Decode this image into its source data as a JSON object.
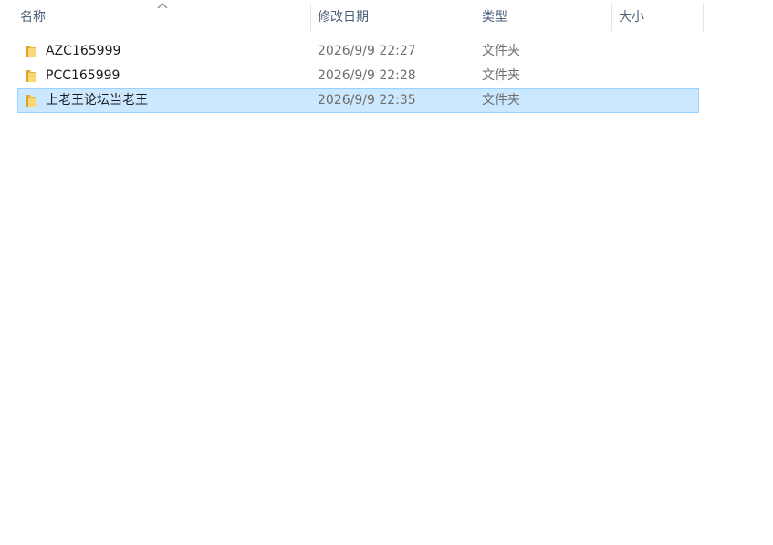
{
  "header": {
    "columns": [
      {
        "label": "名称"
      },
      {
        "label": "修改日期"
      },
      {
        "label": "类型"
      },
      {
        "label": "大小"
      }
    ],
    "sort_icon": "chevron-up-icon"
  },
  "files": [
    {
      "name": "AZC165999",
      "date": "2026/9/9 22:27",
      "type": "文件夹",
      "size": "",
      "icon": "folder-icon",
      "selected": false
    },
    {
      "name": "PCC165999",
      "date": "2026/9/9 22:28",
      "type": "文件夹",
      "size": "",
      "icon": "folder-icon",
      "selected": false
    },
    {
      "name": "上老王论坛当老王",
      "date": "2026/9/9 22:35",
      "type": "文件夹",
      "size": "",
      "icon": "folder-icon",
      "selected": true
    }
  ],
  "colors": {
    "header_text": "#4c607a",
    "selection_bg": "#cce8ff",
    "selection_border": "#99d1ff",
    "folder_yellow": "#f8d775"
  }
}
